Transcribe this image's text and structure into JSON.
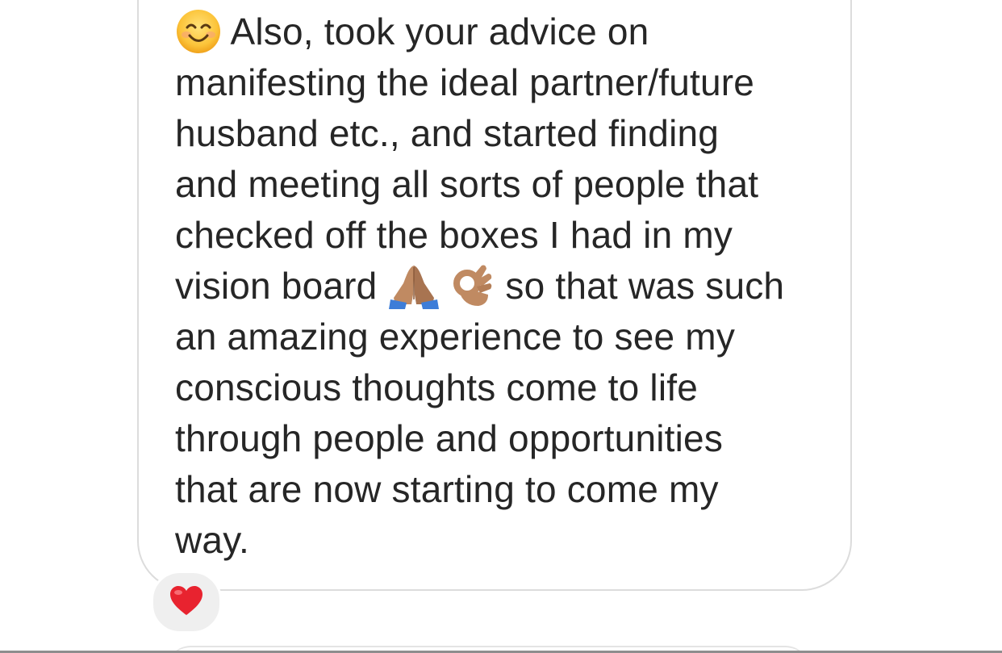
{
  "message": {
    "lines": [
      {
        "emoji_prefix": "smiling-face-emoji",
        "text": "Also, took your advice on"
      },
      {
        "text": "manifesting the ideal partner/future"
      },
      {
        "text": "husband etc., and started finding"
      },
      {
        "text": "and meeting all sorts of people that"
      },
      {
        "text": "checked off the boxes I had in my"
      },
      {
        "text_before": "vision board",
        "emoji_1": "folded-hands-emoji",
        "emoji_2": "ok-hand-emoji",
        "text_after": "so that was such"
      },
      {
        "text": "an amazing experience to see my"
      },
      {
        "text": "conscious thoughts come to life"
      },
      {
        "text": "through people and opportunities"
      },
      {
        "text": "that are now starting to come my"
      },
      {
        "text": "way."
      }
    ]
  },
  "reaction": {
    "emoji": "red-heart-emoji",
    "color": "#e8232f"
  },
  "colors": {
    "text": "#262626",
    "bubble_border": "#dcdcdc",
    "reaction_bg": "#efefef"
  }
}
